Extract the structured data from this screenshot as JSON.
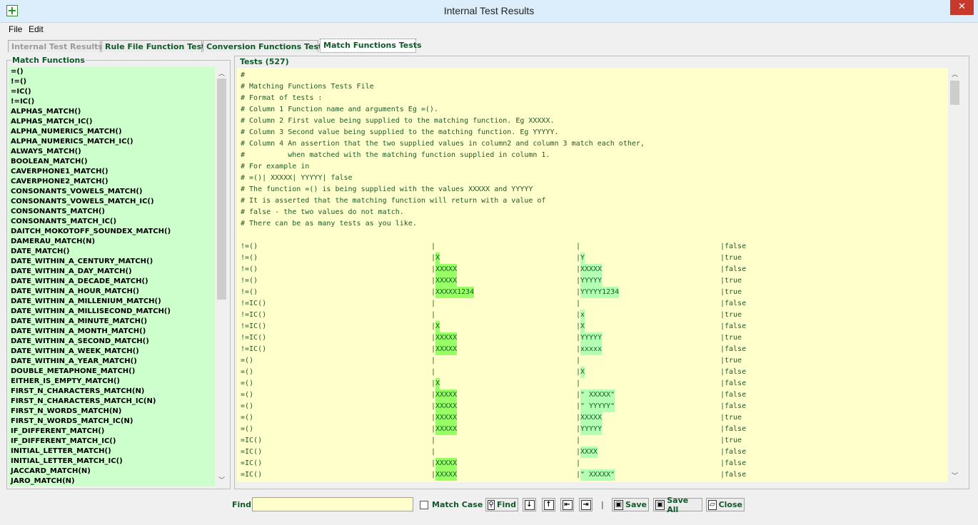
{
  "window": {
    "title": "Internal Test Results",
    "close_glyph": "✕"
  },
  "menu": [
    "File",
    "Edit"
  ],
  "tabs": [
    "Internal Test Results",
    "Rule File Function Tests",
    "Conversion Functions Tests",
    "Match Functions Tests"
  ],
  "left_panel": {
    "title": "Match Functions",
    "items": [
      "=()",
      "!=()",
      "=IC()",
      "!=IC()",
      "ALPHAS_MATCH()",
      "ALPHAS_MATCH_IC()",
      "ALPHA_NUMERICS_MATCH()",
      "ALPHA_NUMERICS_MATCH_IC()",
      "ALWAYS_MATCH()",
      "BOOLEAN_MATCH()",
      "CAVERPHONE1_MATCH()",
      "CAVERPHONE2_MATCH()",
      "CONSONANTS_VOWELS_MATCH()",
      "CONSONANTS_VOWELS_MATCH_IC()",
      "CONSONANTS_MATCH()",
      "CONSONANTS_MATCH_IC()",
      "DAITCH_MOKOTOFF_SOUNDEX_MATCH()",
      "DAMERAU_MATCH(N)",
      "DATE_MATCH()",
      "DATE_WITHIN_A_CENTURY_MATCH()",
      "DATE_WITHIN_A_DAY_MATCH()",
      "DATE_WITHIN_A_DECADE_MATCH()",
      "DATE_WITHIN_A_HOUR_MATCH()",
      "DATE_WITHIN_A_MILLENIUM_MATCH()",
      "DATE_WITHIN_A_MILLISECOND_MATCH()",
      "DATE_WITHIN_A_MINUTE_MATCH()",
      "DATE_WITHIN_A_MONTH_MATCH()",
      "DATE_WITHIN_A_SECOND_MATCH()",
      "DATE_WITHIN_A_WEEK_MATCH()",
      "DATE_WITHIN_A_YEAR_MATCH()",
      "DOUBLE_METAPHONE_MATCH()",
      "EITHER_IS_EMPTY_MATCH()",
      "FIRST_N_CHARACTERS_MATCH(N)",
      "FIRST_N_CHARACTERS_MATCH_IC(N)",
      "FIRST_N_WORDS_MATCH(N)",
      "FIRST_N_WORDS_MATCH_IC(N)",
      "IF_DIFFERENT_MATCH()",
      "IF_DIFFERENT_MATCH_IC()",
      "INITIAL_LETTER_MATCH()",
      "INITIAL_LETTER_MATCH_IC()",
      "JACCARD_MATCH(N)",
      "JARO_MATCH(N)"
    ]
  },
  "tests_panel": {
    "title": "Tests (527)",
    "comments": [
      "#",
      "# Matching Functions Tests File",
      "# Format of tests :",
      "# Column 1 Function name and arguments Eg =().",
      "# Column 2 First value being supplied to the matching function. Eg XXXXX.",
      "# Column 3 Second value being supplied to the matching function. Eg YYYYY.",
      "# Column 4 An assertion that the two supplied values in column2 and column 3 match each other,",
      "#          when matched with the matching function supplied in column 1.",
      "# For example in",
      "# =()| XXXXX| YYYYY| false",
      "# The function =() is being supplied with the values XXXXX and YYYYY",
      "# It is asserted that the matching function will return with a value of",
      "# false - the two values do not match.",
      "# There can be as many tests as you like."
    ],
    "rows": [
      [
        "!=()",
        "",
        "",
        "false"
      ],
      [
        "!=()",
        "X",
        "Y",
        "true"
      ],
      [
        "!=()",
        "XXXXX",
        "XXXXX",
        "false"
      ],
      [
        "!=()",
        "XXXXX",
        "YYYYY",
        "true"
      ],
      [
        "!=()",
        "XXXXX1234",
        "YYYYY1234",
        "true"
      ],
      [
        "!=IC()",
        "",
        "",
        "false"
      ],
      [
        "!=IC()",
        "",
        "x",
        "true"
      ],
      [
        "!=IC()",
        "X",
        "X",
        "false"
      ],
      [
        "!=IC()",
        "XXXXX",
        "YYYYY",
        "true"
      ],
      [
        "!=IC()",
        "XXXXX",
        "xxxxx",
        "false"
      ],
      [
        "=()",
        "",
        "",
        "true"
      ],
      [
        "=()",
        "",
        "X",
        "false"
      ],
      [
        "=()",
        "X",
        "",
        "false"
      ],
      [
        "=()",
        "XXXXX",
        "\" XXXXX\"",
        "false"
      ],
      [
        "=()",
        "XXXXX",
        "\" YYYYY\"",
        "false"
      ],
      [
        "=()",
        "XXXXX",
        "XXXXX",
        "true"
      ],
      [
        "=()",
        "XXXXX",
        "YYYYY",
        "false"
      ],
      [
        "=IC()",
        "",
        "",
        "true"
      ],
      [
        "=IC()",
        "",
        "XXXX",
        "false"
      ],
      [
        "=IC()",
        "XXXXX",
        "",
        "false"
      ],
      [
        "=IC()",
        "XXXXX",
        "\" XXXXX\"",
        "false"
      ]
    ],
    "separator": "|"
  },
  "bottom": {
    "find_label": "Find",
    "find_value": "",
    "match_case_label": "Match Case",
    "find_button": "Find",
    "pipe": "|",
    "save_button": "Save",
    "save_all_button": "Save All",
    "close_button": "Close"
  }
}
